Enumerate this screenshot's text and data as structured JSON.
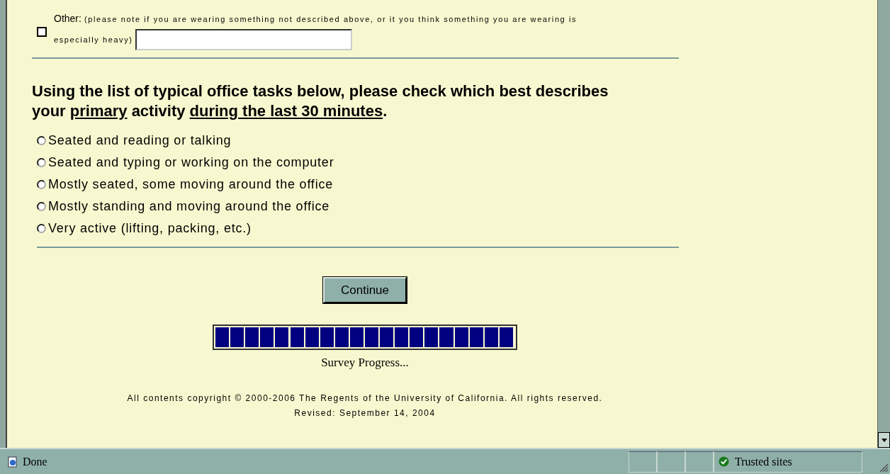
{
  "other_option": {
    "label": "Other:",
    "note": "(please note if you are wearing something not described above, or it you think something you are wearing is",
    "note_end": "especially heavy)",
    "checked": false
  },
  "question": {
    "parts": [
      {
        "text": "Using the list of typical office tasks below, please check which best describes your ",
        "underline": false
      },
      {
        "text": "primary",
        "underline": true
      },
      {
        "text": " activity ",
        "underline": false
      },
      {
        "text": "during the last 30 minutes",
        "underline": true
      },
      {
        "text": ".",
        "underline": false
      }
    ]
  },
  "options": [
    {
      "label": "Seated and reading or talking",
      "selected": false
    },
    {
      "label": "Seated and typing or working on the computer",
      "selected": false
    },
    {
      "label": "Mostly seated, some moving around the office",
      "selected": false
    },
    {
      "label": "Mostly standing and moving around the office",
      "selected": false
    },
    {
      "label": "Very active (lifting, packing, etc.)",
      "selected": false
    }
  ],
  "continue_button": "Continue",
  "progress": {
    "level": 1,
    "caption": "Survey Progress..."
  },
  "footer": [
    "All contents copyright © 2000-2006 The Regents of the University of California. All rights reserved.",
    "Revised: September 14, 2004"
  ],
  "status_bar": {
    "text": "Done",
    "zone": "Trusted sites"
  }
}
